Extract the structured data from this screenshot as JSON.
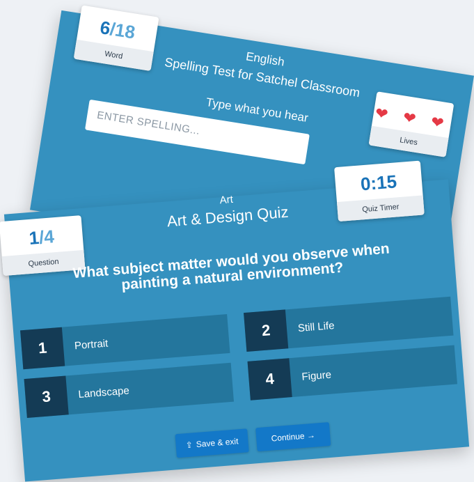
{
  "spelling": {
    "word_current": "6",
    "word_total": "/18",
    "word_label": "Word",
    "subject": "English",
    "title": "Spelling Test for Satchel Classroom",
    "instruction": "Type what you hear",
    "input_placeholder": "ENTER SPELLING...",
    "lives_icons": "❤ ❤ ❤",
    "lives_count": 3,
    "lives_label": "Lives"
  },
  "quiz": {
    "question_current": "1",
    "question_total": "/4",
    "question_label": "Question",
    "subject": "Art",
    "title": "Art & Design Quiz",
    "timer_value": "0:15",
    "timer_label": "Quiz Timer",
    "question": "What subject matter would you observe when painting a natural environment?",
    "answers": [
      {
        "number": "1",
        "label": "Portrait"
      },
      {
        "number": "2",
        "label": "Still Life"
      },
      {
        "number": "3",
        "label": "Landscape"
      },
      {
        "number": "4",
        "label": "Figure"
      }
    ],
    "save_label": "Save & exit",
    "continue_label": "Continue →"
  },
  "colors": {
    "card": "#3591bf",
    "answer_bg": "#24769d",
    "answer_num_bg": "#143b55",
    "button": "#1378c8",
    "heart": "#e53945"
  }
}
